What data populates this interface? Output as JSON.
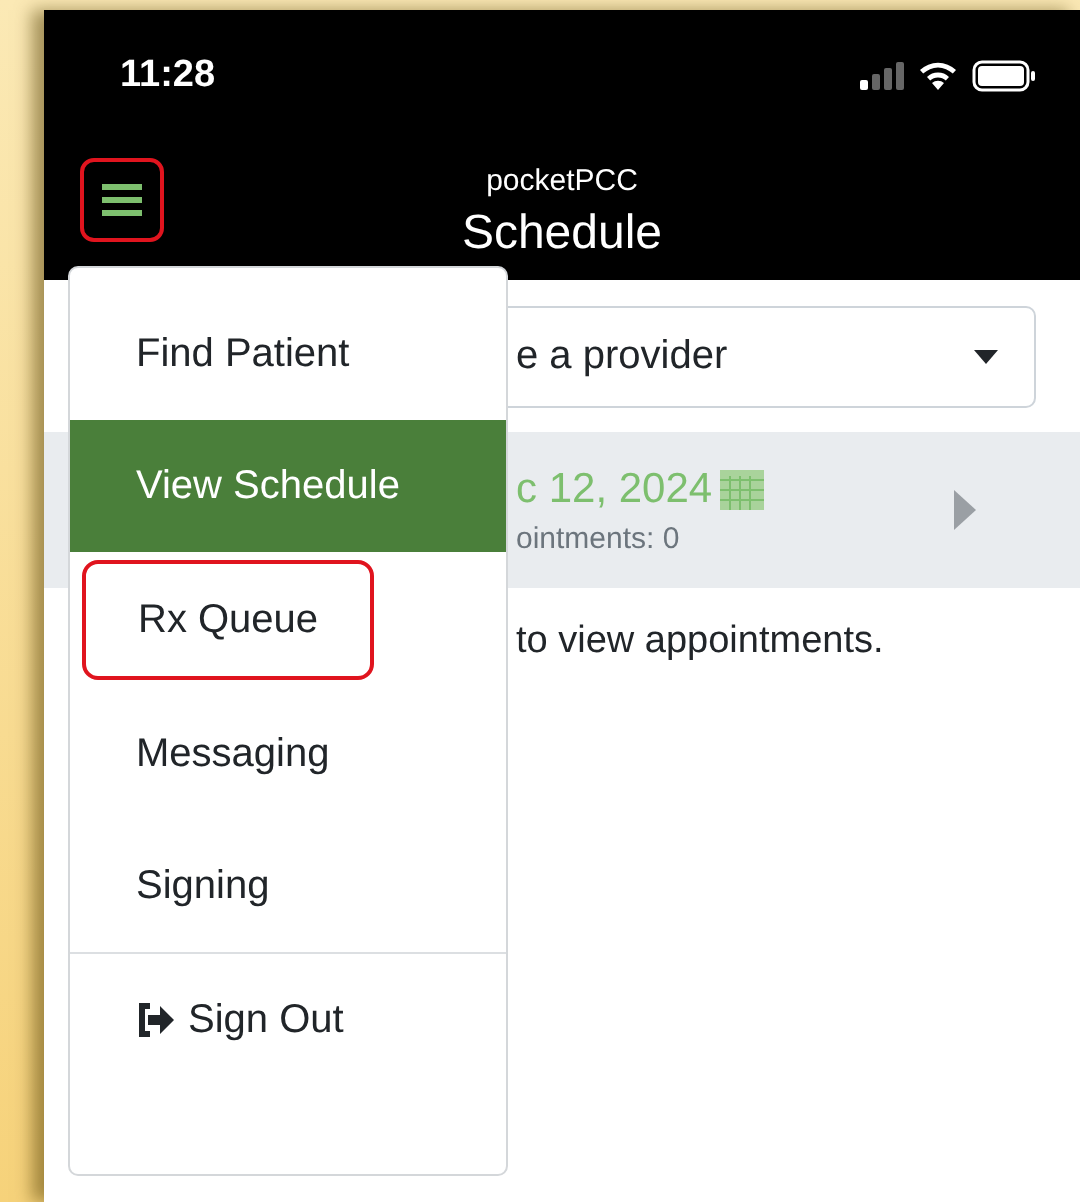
{
  "status_bar": {
    "time": "11:28"
  },
  "header": {
    "app_name": "pocketPCC",
    "title": "Schedule",
    "menu_button": {
      "highlighted": true
    }
  },
  "provider_select": {
    "value": "e a provider"
  },
  "date_row": {
    "date": "c 12, 2024",
    "count": "ointments: 0"
  },
  "message": "to view appointments.",
  "menu": {
    "items": [
      {
        "label": "Find Patient",
        "kind": "item",
        "selected": false,
        "highlighted": false
      },
      {
        "label": "View Schedule",
        "kind": "item",
        "selected": true,
        "highlighted": false
      },
      {
        "label": "Rx Queue",
        "kind": "item",
        "selected": false,
        "highlighted": true
      },
      {
        "label": "Messaging",
        "kind": "item",
        "selected": false,
        "highlighted": false
      },
      {
        "label": "Signing",
        "kind": "item",
        "selected": false,
        "highlighted": false
      },
      {
        "label": "Sign Out",
        "kind": "signout",
        "selected": false,
        "highlighted": false
      }
    ]
  }
}
